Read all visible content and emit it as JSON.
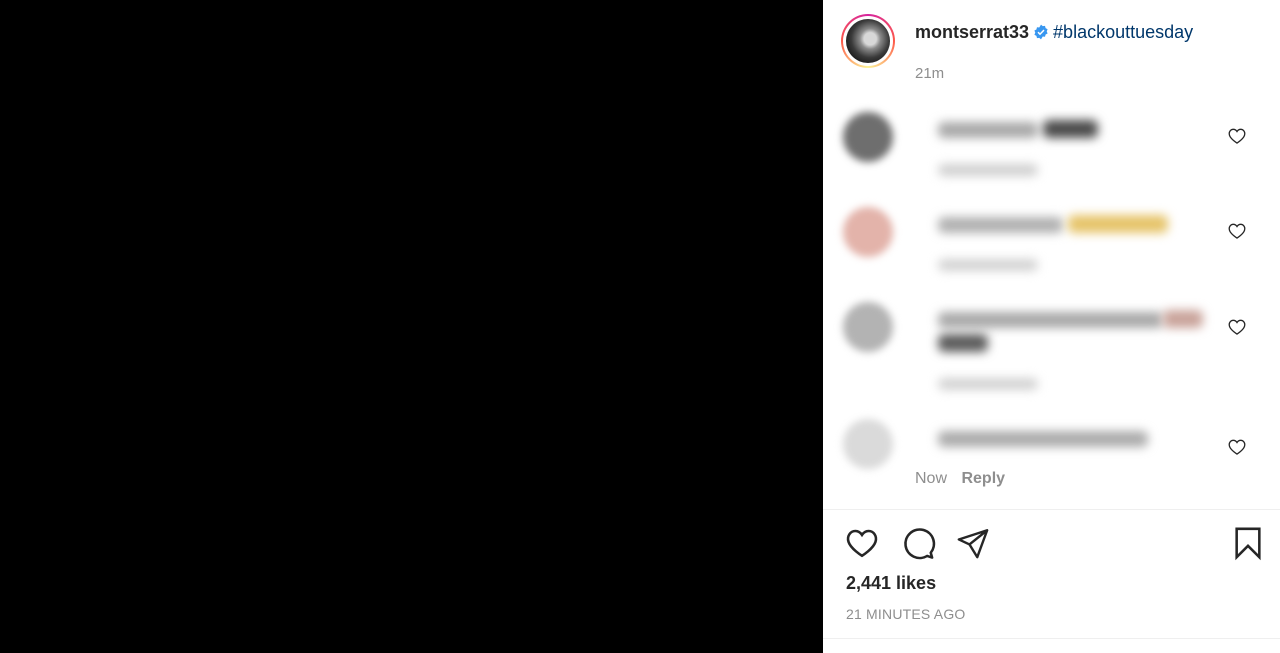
{
  "post": {
    "username": "montserrat33",
    "hashtag": "#blackouttuesday",
    "caption_time": "21m"
  },
  "comments": [
    {
      "avatar_color": "#6e6e6e",
      "bar1": "#9a9a9a",
      "bar2": "#5a5a5a"
    },
    {
      "avatar_color": "#e8b8b0",
      "bar1": "#a8a8a8",
      "bar2": "#e6c46a"
    },
    {
      "avatar_color": "#b0b0b0",
      "bar1": "#9e9e9e",
      "bar2": "#c9a39a"
    },
    {
      "avatar_color": "#d9d9d9",
      "bar1": "#a0a0a0",
      "bar2": "#bdbdbd"
    }
  ],
  "last_comment_meta": {
    "time": "Now",
    "reply": "Reply"
  },
  "actions": {
    "like_icon": "heart-icon",
    "comment_icon": "comment-icon",
    "share_icon": "paper-plane-icon",
    "save_icon": "bookmark-icon"
  },
  "likes_text": "2,441 likes",
  "time_ago": "21 MINUTES AGO",
  "colors": {
    "verified": "#3897f0",
    "hashtag": "#00376b",
    "muted": "#8e8e8e",
    "text": "#262626"
  }
}
